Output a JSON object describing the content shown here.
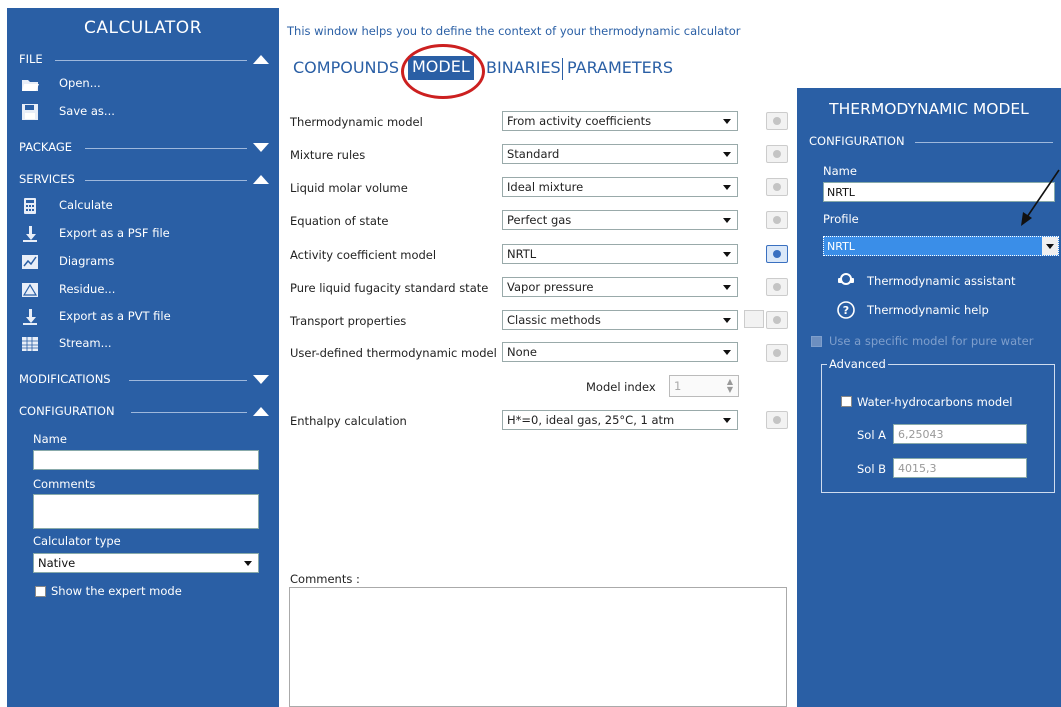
{
  "sidebar": {
    "title": "CALCULATOR",
    "file": {
      "label": "FILE",
      "items": [
        "Open...",
        "Save as..."
      ]
    },
    "package": {
      "label": "PACKAGE"
    },
    "services": {
      "label": "SERVICES",
      "items": [
        "Calculate",
        "Export as a PSF file",
        "Diagrams",
        "Residue...",
        "Export as a PVT file",
        "Stream..."
      ]
    },
    "modifications": {
      "label": "MODIFICATIONS"
    },
    "configuration": {
      "label": "CONFIGURATION",
      "name_label": "Name",
      "comments_label": "Comments",
      "calc_type_label": "Calculator type",
      "calc_type_value": "Native",
      "expert_label": "Show the expert mode"
    }
  },
  "main": {
    "hint": "This window helps you to define the context of your thermodynamic calculator",
    "tabs": [
      "COMPOUNDS",
      "MODEL",
      "BINARIES",
      "PARAMETERS"
    ],
    "active_tab": "MODEL",
    "rows": [
      {
        "label": "Thermodynamic model",
        "value": "From activity coefficients"
      },
      {
        "label": "Mixture rules",
        "value": "Standard"
      },
      {
        "label": "Liquid molar volume",
        "value": "Ideal mixture"
      },
      {
        "label": "Equation of state",
        "value": "Perfect gas"
      },
      {
        "label": "Activity coefficient model",
        "value": "NRTL"
      },
      {
        "label": "Pure liquid fugacity standard state",
        "value": "Vapor pressure"
      },
      {
        "label": "Transport properties",
        "value": "Classic methods"
      },
      {
        "label": "User-defined thermodynamic model",
        "value": "None"
      }
    ],
    "model_index_label": "Model index",
    "model_index_value": "1",
    "enthalpy": {
      "label": "Enthalpy calculation",
      "value": "H*=0, ideal gas, 25°C, 1 atm"
    },
    "comments_label": "Comments :"
  },
  "panel": {
    "title": "THERMODYNAMIC MODEL",
    "configuration_label": "CONFIGURATION",
    "name_label": "Name",
    "name_value": "NRTL",
    "profile_label": "Profile",
    "profile_value": "NRTL",
    "assistant_label": "Thermodynamic assistant",
    "help_label": "Thermodynamic help",
    "specific_model_label": "Use a specific model for pure water",
    "advanced_label": "Advanced",
    "water_hc_label": "Water-hydrocarbons model",
    "sol_a_label": "Sol A",
    "sol_a_value": "6,25043",
    "sol_b_label": "Sol B",
    "sol_b_value": "4015,3"
  },
  "colors": {
    "brand_blue": "#2a5fa5",
    "highlight": "#cc2020",
    "selection": "#3a8ee8"
  }
}
